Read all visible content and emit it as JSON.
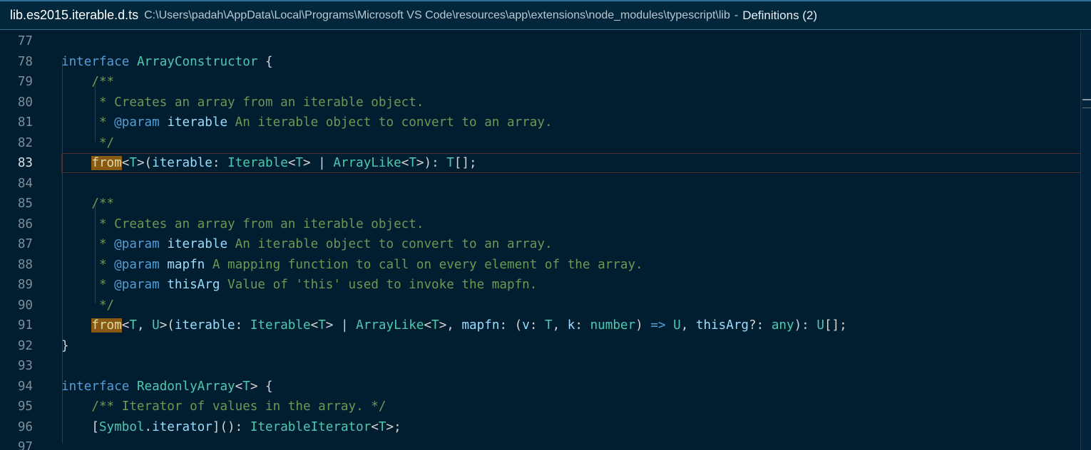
{
  "peek": {
    "file": "lib.es2015.iterable.d.ts",
    "path": "C:\\Users\\padah\\AppData\\Local\\Programs\\Microsoft VS Code\\resources\\app\\extensions\\node_modules\\typescript\\lib",
    "separator": "-",
    "definitions": "Definitions (2)"
  },
  "lines": [
    {
      "n": "77",
      "segs": []
    },
    {
      "n": "78",
      "segs": [
        {
          "t": "interface ",
          "c": "kw"
        },
        {
          "t": "ArrayConstructor",
          "c": "ty"
        },
        {
          "t": " {",
          "c": ""
        }
      ]
    },
    {
      "n": "79",
      "segs": [
        {
          "t": "    /**",
          "c": "cm"
        }
      ]
    },
    {
      "n": "80",
      "segs": [
        {
          "t": "     * Creates an array from an iterable object.",
          "c": "cm"
        }
      ]
    },
    {
      "n": "81",
      "segs": [
        {
          "t": "     * ",
          "c": "cm"
        },
        {
          "t": "@param",
          "c": "tg"
        },
        {
          "t": " ",
          "c": "cm"
        },
        {
          "t": "iterable",
          "c": "id"
        },
        {
          "t": " An iterable object to convert to an array.",
          "c": "cm"
        }
      ]
    },
    {
      "n": "82",
      "segs": [
        {
          "t": "     */",
          "c": "cm"
        }
      ]
    },
    {
      "n": "83",
      "active": true,
      "segs": [
        {
          "t": "    ",
          "c": ""
        },
        {
          "t": "from",
          "c": "fnhl"
        },
        {
          "t": "<",
          "c": ""
        },
        {
          "t": "T",
          "c": "ty"
        },
        {
          "t": ">(",
          "c": ""
        },
        {
          "t": "iterable",
          "c": "id"
        },
        {
          "t": ": ",
          "c": ""
        },
        {
          "t": "Iterable",
          "c": "ty"
        },
        {
          "t": "<",
          "c": ""
        },
        {
          "t": "T",
          "c": "ty"
        },
        {
          "t": "> | ",
          "c": ""
        },
        {
          "t": "ArrayLike",
          "c": "ty"
        },
        {
          "t": "<",
          "c": ""
        },
        {
          "t": "T",
          "c": "ty"
        },
        {
          "t": ">): ",
          "c": ""
        },
        {
          "t": "T",
          "c": "ty"
        },
        {
          "t": "[];",
          "c": ""
        }
      ]
    },
    {
      "n": "84",
      "segs": []
    },
    {
      "n": "85",
      "segs": [
        {
          "t": "    /**",
          "c": "cm"
        }
      ]
    },
    {
      "n": "86",
      "segs": [
        {
          "t": "     * Creates an array from an iterable object.",
          "c": "cm"
        }
      ]
    },
    {
      "n": "87",
      "segs": [
        {
          "t": "     * ",
          "c": "cm"
        },
        {
          "t": "@param",
          "c": "tg"
        },
        {
          "t": " ",
          "c": "cm"
        },
        {
          "t": "iterable",
          "c": "id"
        },
        {
          "t": " An iterable object to convert to an array.",
          "c": "cm"
        }
      ]
    },
    {
      "n": "88",
      "segs": [
        {
          "t": "     * ",
          "c": "cm"
        },
        {
          "t": "@param",
          "c": "tg"
        },
        {
          "t": " ",
          "c": "cm"
        },
        {
          "t": "mapfn",
          "c": "id"
        },
        {
          "t": " A mapping function to call on every element of the array.",
          "c": "cm"
        }
      ]
    },
    {
      "n": "89",
      "segs": [
        {
          "t": "     * ",
          "c": "cm"
        },
        {
          "t": "@param",
          "c": "tg"
        },
        {
          "t": " ",
          "c": "cm"
        },
        {
          "t": "thisArg",
          "c": "id"
        },
        {
          "t": " Value of 'this' used to invoke the mapfn.",
          "c": "cm"
        }
      ]
    },
    {
      "n": "90",
      "segs": [
        {
          "t": "     */",
          "c": "cm"
        }
      ]
    },
    {
      "n": "91",
      "segs": [
        {
          "t": "    ",
          "c": ""
        },
        {
          "t": "from",
          "c": "fnhl"
        },
        {
          "t": "<",
          "c": ""
        },
        {
          "t": "T",
          "c": "ty"
        },
        {
          "t": ", ",
          "c": ""
        },
        {
          "t": "U",
          "c": "ty"
        },
        {
          "t": ">(",
          "c": ""
        },
        {
          "t": "iterable",
          "c": "id"
        },
        {
          "t": ": ",
          "c": ""
        },
        {
          "t": "Iterable",
          "c": "ty"
        },
        {
          "t": "<",
          "c": ""
        },
        {
          "t": "T",
          "c": "ty"
        },
        {
          "t": "> | ",
          "c": ""
        },
        {
          "t": "ArrayLike",
          "c": "ty"
        },
        {
          "t": "<",
          "c": ""
        },
        {
          "t": "T",
          "c": "ty"
        },
        {
          "t": ">, ",
          "c": ""
        },
        {
          "t": "mapfn",
          "c": "id"
        },
        {
          "t": ": (",
          "c": ""
        },
        {
          "t": "v",
          "c": "id"
        },
        {
          "t": ": ",
          "c": ""
        },
        {
          "t": "T",
          "c": "ty"
        },
        {
          "t": ", ",
          "c": ""
        },
        {
          "t": "k",
          "c": "id"
        },
        {
          "t": ": ",
          "c": ""
        },
        {
          "t": "number",
          "c": "ty"
        },
        {
          "t": ") ",
          "c": ""
        },
        {
          "t": "=>",
          "c": "kw"
        },
        {
          "t": " ",
          "c": ""
        },
        {
          "t": "U",
          "c": "ty"
        },
        {
          "t": ", ",
          "c": ""
        },
        {
          "t": "thisArg",
          "c": "id"
        },
        {
          "t": "?: ",
          "c": ""
        },
        {
          "t": "any",
          "c": "ty"
        },
        {
          "t": "): ",
          "c": ""
        },
        {
          "t": "U",
          "c": "ty"
        },
        {
          "t": "[];",
          "c": ""
        }
      ]
    },
    {
      "n": "92",
      "segs": [
        {
          "t": "}",
          "c": ""
        }
      ]
    },
    {
      "n": "93",
      "segs": []
    },
    {
      "n": "94",
      "segs": [
        {
          "t": "interface ",
          "c": "kw"
        },
        {
          "t": "ReadonlyArray",
          "c": "ty"
        },
        {
          "t": "<",
          "c": ""
        },
        {
          "t": "T",
          "c": "ty"
        },
        {
          "t": "> {",
          "c": ""
        }
      ]
    },
    {
      "n": "95",
      "segs": [
        {
          "t": "    /** Iterator of values in the array. */",
          "c": "cm"
        }
      ]
    },
    {
      "n": "96",
      "segs": [
        {
          "t": "    [",
          "c": ""
        },
        {
          "t": "Symbol",
          "c": "ty"
        },
        {
          "t": ".",
          "c": ""
        },
        {
          "t": "iterator",
          "c": "id"
        },
        {
          "t": "](): ",
          "c": ""
        },
        {
          "t": "IterableIterator",
          "c": "ty"
        },
        {
          "t": "<",
          "c": ""
        },
        {
          "t": "T",
          "c": "ty"
        },
        {
          "t": ">;",
          "c": ""
        }
      ]
    },
    {
      "n": "97",
      "segs": []
    }
  ]
}
